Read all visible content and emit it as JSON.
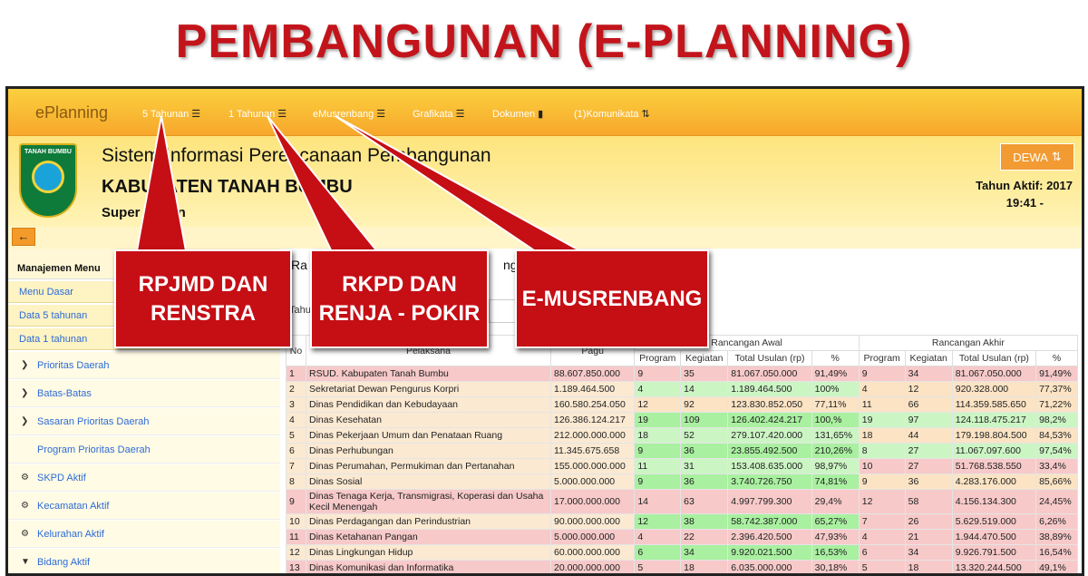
{
  "headline": "PEMBANGUNAN (E-PLANNING)",
  "navbar": {
    "brand": "ePlanning",
    "items": [
      {
        "label": "5 Tahunan",
        "icon": "list-icon"
      },
      {
        "label": "1 Tahunan",
        "icon": "list-icon"
      },
      {
        "label": "eMusrenbang",
        "icon": "list-icon"
      },
      {
        "label": "Grafikata",
        "icon": "list-icon"
      },
      {
        "label": "Dokumen",
        "icon": "bookmark-icon"
      },
      {
        "label": "(1)Komunikata",
        "icon": "retweet-icon"
      }
    ]
  },
  "header": {
    "logo_text": "TANAH BUMBU",
    "system_title": "Sistem Informasi Perencanaan Pembangunan",
    "regency": "KABUPATEN TANAH BUMBU",
    "role": "Super Admin",
    "user_button": "DEWA",
    "active_year": "Tahun Aktif: 2017",
    "clock": "19:41 -"
  },
  "sidebar": {
    "title": "Manajemen Menu",
    "items": [
      "Menu Dasar",
      "Data 5 tahunan",
      "Data 1 tahunan"
    ],
    "subitems": [
      {
        "label": "Prioritas Daerah",
        "icon": "chevron-right-icon"
      },
      {
        "label": "Batas-Batas",
        "icon": "chevron-right-icon"
      },
      {
        "label": "Sasaran Prioritas Daerah",
        "icon": "chevron-right-icon"
      },
      {
        "label": "Program Prioritas Daerah",
        "icon": "none"
      },
      {
        "label": "SKPD Aktif",
        "icon": "gear-icon"
      },
      {
        "label": "Kecamatan Aktif",
        "icon": "gear-icon"
      },
      {
        "label": "Kelurahan Aktif",
        "icon": "gear-icon"
      },
      {
        "label": "Bidang Aktif",
        "icon": "filter-icon"
      }
    ]
  },
  "content": {
    "title_visible": "Ra",
    "title_tail": "ngan",
    "filter_label": "Tahun"
  },
  "table": {
    "group_headers": {
      "awal": "Rancangan Awal",
      "akhir": "Rancangan Akhir"
    },
    "headers": [
      "No",
      "Pelaksana",
      "Pagu",
      "Program",
      "Kegiatan",
      "Total Usulan (rp)",
      "%",
      "Program",
      "Kegiatan",
      "Total Usulan (rp)",
      "%"
    ],
    "rows": [
      {
        "no": "1",
        "name": "RSUD. Kabupaten Tanah Bumbu",
        "pagu": "88.607.850.000",
        "p1": "9",
        "k1": "35",
        "t1": "81.067.050.000",
        "pc1": "91,49%",
        "p2": "9",
        "k2": "34",
        "t2": "81.067.050.000",
        "pc2": "91,49%",
        "c1": "#f7c9c9",
        "c2": "#f7c9c9"
      },
      {
        "no": "2",
        "name": "Sekretariat Dewan Pengurus Korpri",
        "pagu": "1.189.464.500",
        "p1": "4",
        "k1": "14",
        "t1": "1.189.464.500",
        "pc1": "100%",
        "p2": "4",
        "k2": "12",
        "t2": "920.328.000",
        "pc2": "77,37%",
        "c1": "#ccf5c4",
        "c2": "#fbe3c4"
      },
      {
        "no": "3",
        "name": "Dinas Pendidikan dan Kebudayaan",
        "pagu": "160.580.254.050",
        "p1": "12",
        "k1": "92",
        "t1": "123.830.852.050",
        "pc1": "77,11%",
        "p2": "11",
        "k2": "66",
        "t2": "114.359.585.650",
        "pc2": "71,22%",
        "c1": "#fbe3c4",
        "c2": "#fbe3c4"
      },
      {
        "no": "4",
        "name": "Dinas Kesehatan",
        "pagu": "126.386.124.217",
        "p1": "19",
        "k1": "109",
        "t1": "126.402.424.217",
        "pc1": "100,%",
        "p2": "19",
        "k2": "97",
        "t2": "124.118.475.217",
        "pc2": "98,2%",
        "c1": "#a9f0a0",
        "c2": "#ccf5c4"
      },
      {
        "no": "5",
        "name": "Dinas Pekerjaan Umum dan Penataan Ruang",
        "pagu": "212.000.000.000",
        "p1": "18",
        "k1": "52",
        "t1": "279.107.420.000",
        "pc1": "131,65%",
        "p2": "18",
        "k2": "44",
        "t2": "179.198.804.500",
        "pc2": "84,53%",
        "c1": "#ccf5c4",
        "c2": "#fbe3c4"
      },
      {
        "no": "6",
        "name": "Dinas Perhubungan",
        "pagu": "11.345.675.658",
        "p1": "9",
        "k1": "36",
        "t1": "23.855.492.500",
        "pc1": "210,26%",
        "p2": "8",
        "k2": "27",
        "t2": "11.067.097.600",
        "pc2": "97,54%",
        "c1": "#a9f0a0",
        "c2": "#ccf5c4"
      },
      {
        "no": "7",
        "name": "Dinas Perumahan, Permukiman dan Pertanahan",
        "pagu": "155.000.000.000",
        "p1": "11",
        "k1": "31",
        "t1": "153.408.635.000",
        "pc1": "98,97%",
        "p2": "10",
        "k2": "27",
        "t2": "51.768.538.550",
        "pc2": "33,4%",
        "c1": "#ccf5c4",
        "c2": "#f7c9c9"
      },
      {
        "no": "8",
        "name": "Dinas Sosial",
        "pagu": "5.000.000.000",
        "p1": "9",
        "k1": "36",
        "t1": "3.740.726.750",
        "pc1": "74,81%",
        "p2": "9",
        "k2": "36",
        "t2": "4.283.176.000",
        "pc2": "85,66%",
        "c1": "#a9f0a0",
        "c2": "#fbe3c4"
      },
      {
        "no": "9",
        "name": "Dinas Tenaga Kerja, Transmigrasi, Koperasi dan Usaha Kecil Menengah",
        "pagu": "17.000.000.000",
        "p1": "14",
        "k1": "63",
        "t1": "4.997.799.300",
        "pc1": "29,4%",
        "p2": "12",
        "k2": "58",
        "t2": "4.156.134.300",
        "pc2": "24,45%",
        "c1": "#f7c9c9",
        "c2": "#f7c9c9"
      },
      {
        "no": "10",
        "name": "Dinas Perdagangan dan Perindustrian",
        "pagu": "90.000.000.000",
        "p1": "12",
        "k1": "38",
        "t1": "58.742.387.000",
        "pc1": "65,27%",
        "p2": "7",
        "k2": "26",
        "t2": "5.629.519.000",
        "pc2": "6,26%",
        "c1": "#a9f0a0",
        "c2": "#f7c9c9"
      },
      {
        "no": "11",
        "name": "Dinas Ketahanan Pangan",
        "pagu": "5.000.000.000",
        "p1": "4",
        "k1": "22",
        "t1": "2.396.420.500",
        "pc1": "47,93%",
        "p2": "4",
        "k2": "21",
        "t2": "1.944.470.500",
        "pc2": "38,89%",
        "c1": "#f7c9c9",
        "c2": "#f7c9c9"
      },
      {
        "no": "12",
        "name": "Dinas Lingkungan Hidup",
        "pagu": "60.000.000.000",
        "p1": "6",
        "k1": "34",
        "t1": "9.920.021.500",
        "pc1": "16,53%",
        "p2": "6",
        "k2": "34",
        "t2": "9.926.791.500",
        "pc2": "16,54%",
        "c1": "#a9f0a0",
        "c2": "#f7c9c9"
      },
      {
        "no": "13",
        "name": "Dinas Komunikasi dan Informatika",
        "pagu": "20.000.000.000",
        "p1": "5",
        "k1": "18",
        "t1": "6.035.000.000",
        "pc1": "30,18%",
        "p2": "5",
        "k2": "18",
        "t2": "13.320.244.500",
        "pc2": "49,1%",
        "c1": "#f7c9c9",
        "c2": "#f7c9c9"
      }
    ]
  },
  "callouts": {
    "rpjmd": "RPJMD DAN RENSTRA",
    "rkpd": "RKPD DAN RENJA - POKIR",
    "musrenbang": "E-MUSRENBANG"
  },
  "colors": {
    "brand_red": "#c3141b",
    "navbar": "#f7a72b",
    "callout": "#c60e15"
  }
}
